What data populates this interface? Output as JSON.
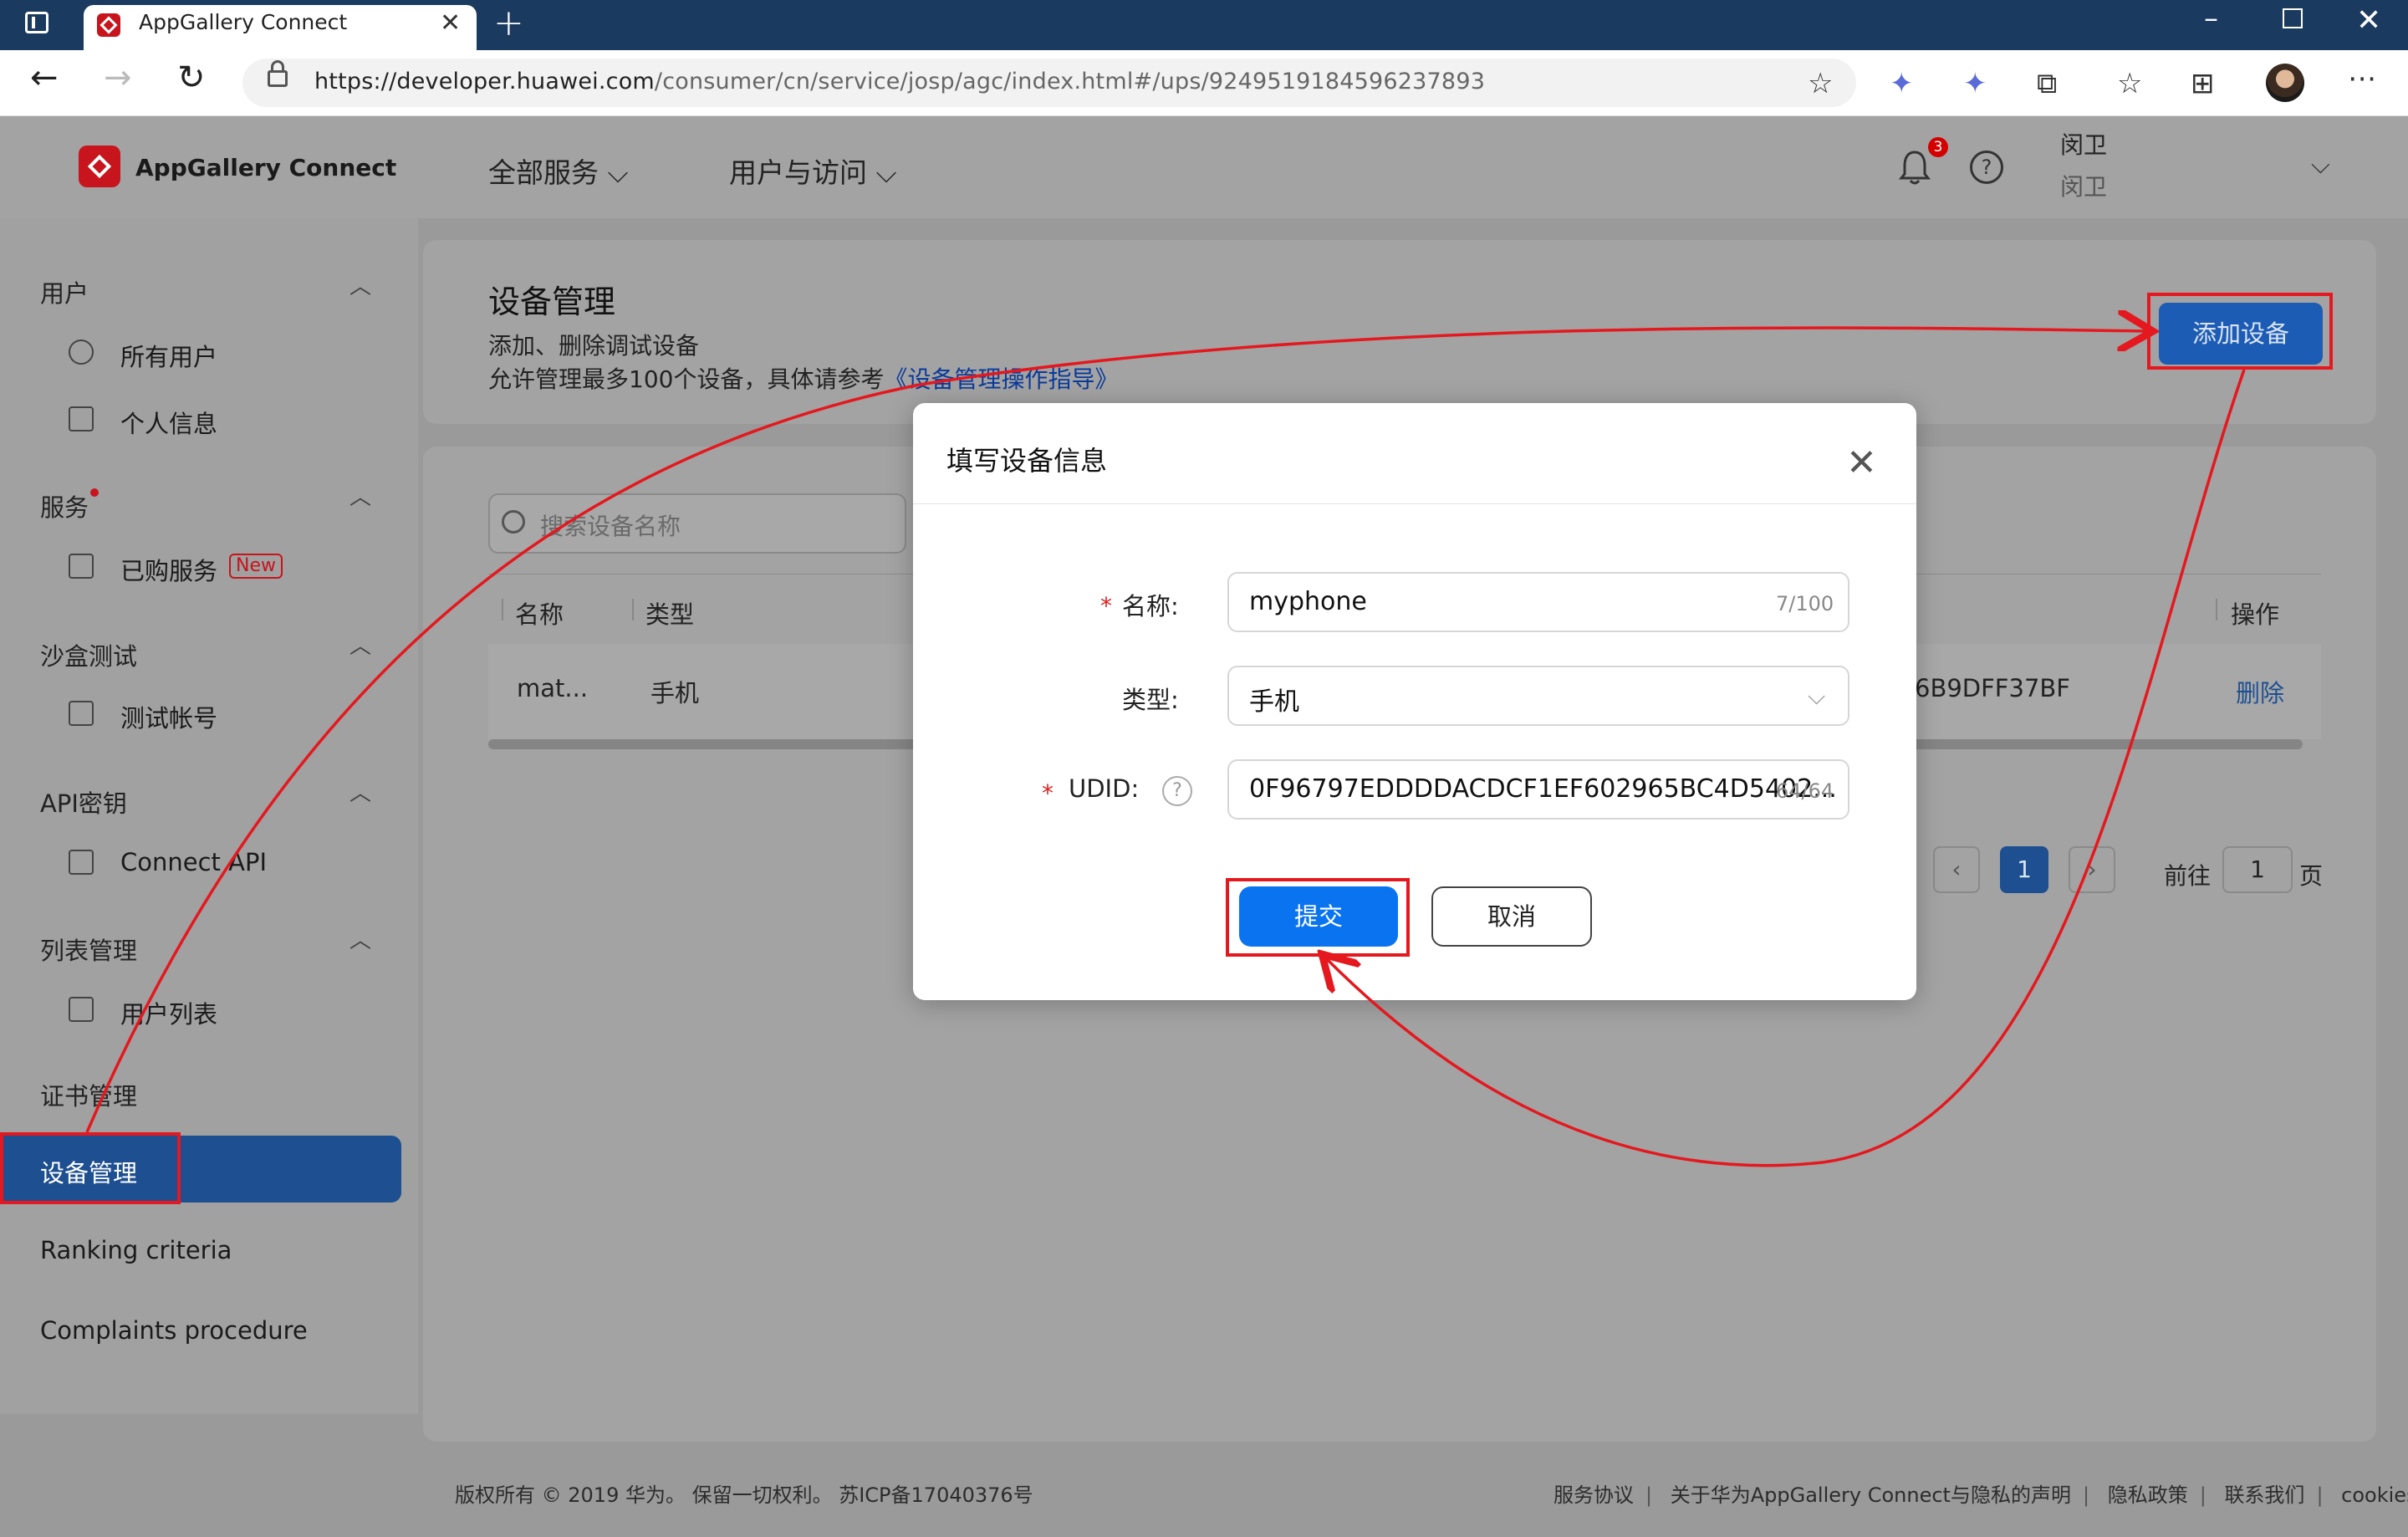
{
  "browser": {
    "tab_title": "AppGallery Connect",
    "url_host": "https://developer.huawei.com",
    "url_path": "/consumer/cn/service/josp/agc/index.html#/ups/9249519184596237893"
  },
  "header": {
    "brand": "AppGallery Connect",
    "menu_all": "全部服务 ⌵",
    "menu_users": "用户与访问 ⌵",
    "notification_count": "3",
    "help": "?",
    "user_name": "闵卫",
    "user_org": "闵卫"
  },
  "sidebar": {
    "sections": {
      "users": "用户",
      "services": "服务",
      "sandbox": "沙盒测试",
      "api_keys": "API密钥",
      "list_mgmt": "列表管理",
      "cert_mgmt": "证书管理",
      "device_mgmt": "设备管理",
      "ranking": "Ranking criteria",
      "complaints": "Complaints procedure"
    },
    "items": {
      "all_users": "所有用户",
      "personal_info": "个人信息",
      "purchased_services": "已购服务",
      "new_badge": "New",
      "test_account": "测试帐号",
      "connect_api": "Connect API",
      "user_list": "用户列表"
    }
  },
  "page": {
    "title": "设备管理",
    "desc1": "添加、删除调试设备",
    "desc2_prefix": "允许管理最多100个设备，具体请参考",
    "desc2_link": "《设备管理操作指导》",
    "add_device": "添加设备",
    "search_placeholder": "搜索设备名称",
    "columns": {
      "name": "名称",
      "type": "类型",
      "actions": "操作"
    },
    "row": {
      "name": "mat...",
      "type": "手机",
      "udid_tail": "6B9DFF37BF",
      "delete": "删除"
    },
    "pagination": {
      "prev": "‹",
      "current": "1",
      "next": "›",
      "goto": "前往",
      "page_input": "1",
      "page_unit": "页"
    }
  },
  "modal": {
    "title": "填写设备信息",
    "name_label": "名称:",
    "name_value": "myphone",
    "name_counter": "7/100",
    "type_label": "类型:",
    "type_value": "手机",
    "udid_label": "UDID:",
    "udid_value": "0F96797EDDDDACDCF1EF602965BC4D5402...",
    "udid_counter": "64/64",
    "submit": "提交",
    "cancel": "取消"
  },
  "footer": {
    "copyright": "版权所有 © 2019 华为。 保留一切权利。 苏ICP备17040376号",
    "links": [
      "服务协议",
      "关于华为AppGallery Connect与隐私的声明",
      "隐私政策",
      "联系我们",
      "cookies"
    ]
  },
  "colors": {
    "accent": "#0a74f0",
    "annotation": "#e4181e",
    "brand": "#c8141c"
  }
}
